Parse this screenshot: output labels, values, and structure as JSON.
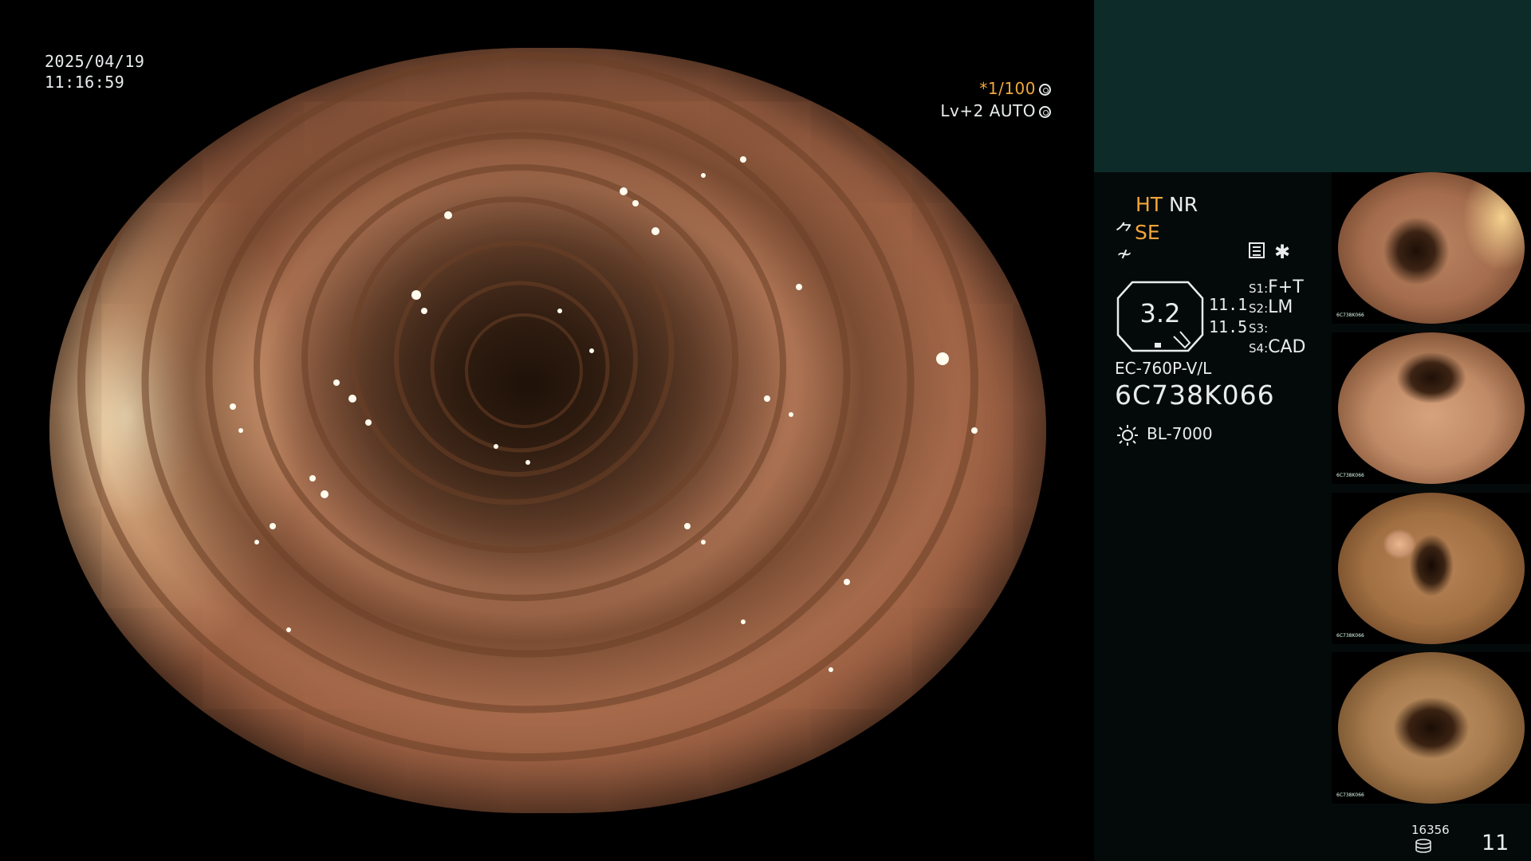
{
  "overlay": {
    "date": "2025/04/19",
    "time": "11:16:59",
    "shutter": "*1/100",
    "exposure": "Lv+2 AUTO"
  },
  "status": {
    "mode_ht": "HT",
    "mode_nr": "NR",
    "mode_se": "SE",
    "octagon_value": "3.2",
    "value_a": "11.1",
    "value_b": "11.5",
    "s1_key": "S1:",
    "s1_val": "F+T",
    "s2_key": "S2:",
    "s2_val": "LM",
    "s3_key": "S3:",
    "s3_val": "",
    "s4_key": "S4:",
    "s4_val": "CAD",
    "scope_model": "EC-760P-V/L",
    "scope_serial": "6C738K066",
    "light_source": "BL-7000"
  },
  "footer": {
    "image_count": "16356",
    "frame_number": "11"
  },
  "thumbnail_serial": "6C738K066",
  "colors": {
    "accent_orange": "#f2a53a",
    "panel_top": "#0d2b29",
    "panel_bg": "#040a0a"
  },
  "icons": [
    "shutter-ring-icon",
    "exposure-ring-icon",
    "scope-tip-icon",
    "frame-freeze-icon",
    "menu-icon",
    "asterisk-icon",
    "light-source-sun-icon",
    "database-icon"
  ]
}
